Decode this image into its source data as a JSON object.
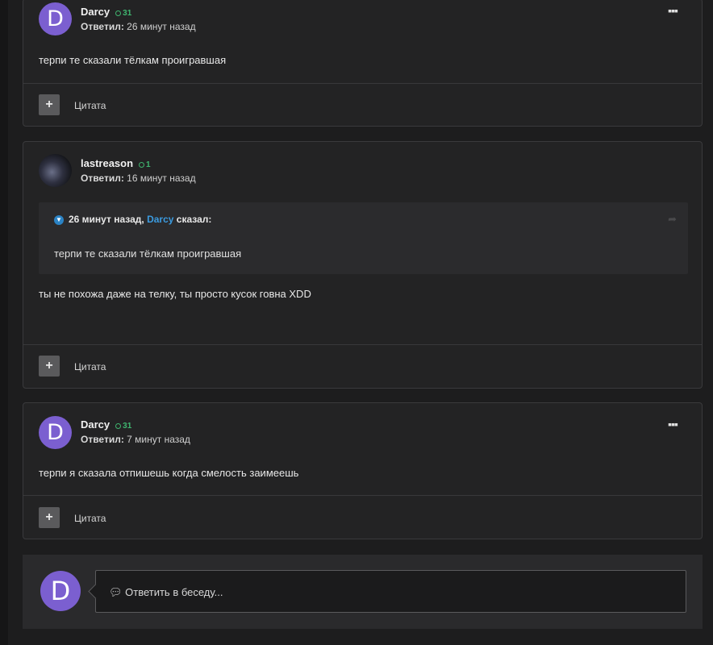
{
  "posts": [
    {
      "author": "Darcy",
      "reputation": "31",
      "avatar_letter": "D",
      "replied_label": "Ответил:",
      "time": "26 минут назад",
      "text": "терпи те сказали тёлкам проигравшая",
      "quote_button_label": "Цитата",
      "menu_icon": "ellipsis-icon"
    },
    {
      "author": "lastreason",
      "reputation": "1",
      "replied_label": "Ответил:",
      "time": "16 минут назад",
      "quote": {
        "time": "26 минут назад,",
        "author": "Darcy",
        "said": "сказал:",
        "text": "терпи те сказали тёлкам проигравшая"
      },
      "text": "ты не похожа даже на телку, ты просто кусок говна XDD",
      "quote_button_label": "Цитата"
    },
    {
      "author": "Darcy",
      "reputation": "31",
      "avatar_letter": "D",
      "replied_label": "Ответил:",
      "time": "7 минут назад",
      "text": "терпи я сказала отпишешь когда смелость заимеешь",
      "quote_button_label": "Цитата",
      "menu_icon": "ellipsis-icon"
    }
  ],
  "reply": {
    "avatar_letter": "D",
    "placeholder": "Ответить в беседу..."
  },
  "colors": {
    "accent_blue": "#3b9be0",
    "reputation_green": "#3fb56f",
    "avatar_purple": "#7b5fd0"
  }
}
